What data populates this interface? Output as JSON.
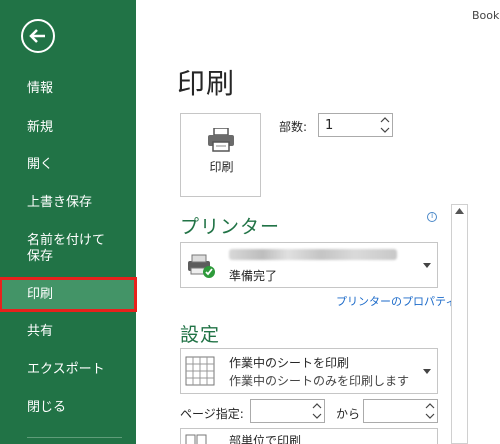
{
  "window": {
    "title": "Book"
  },
  "sidebar": {
    "accent": "#217346",
    "selected_bg": "#439467",
    "highlight_border": "#e8211c",
    "back_icon": "arrow-left-circle-icon",
    "items": [
      {
        "label": "情報"
      },
      {
        "label": "新規"
      },
      {
        "label": "開く"
      },
      {
        "label": "上書き保存"
      },
      {
        "label": "名前を付けて\n保存"
      },
      {
        "label": "印刷",
        "selected": true
      },
      {
        "label": "共有"
      },
      {
        "label": "エクスポート"
      },
      {
        "label": "閉じる"
      }
    ]
  },
  "main": {
    "page_title": "印刷",
    "print_button_label": "印刷",
    "copies_label": "部数:",
    "copies_value": "1",
    "printer_section_title": "プリンター",
    "printer_status": "準備完了",
    "printer_properties_link": "プリンターのプロパティ",
    "settings_section_title": "設定",
    "print_what_main": "作業中のシートを印刷",
    "print_what_sub": "作業中のシートのみを印刷します",
    "pages_label": "ページ指定:",
    "to_label": "から",
    "collate_main": "部単位で印刷"
  }
}
